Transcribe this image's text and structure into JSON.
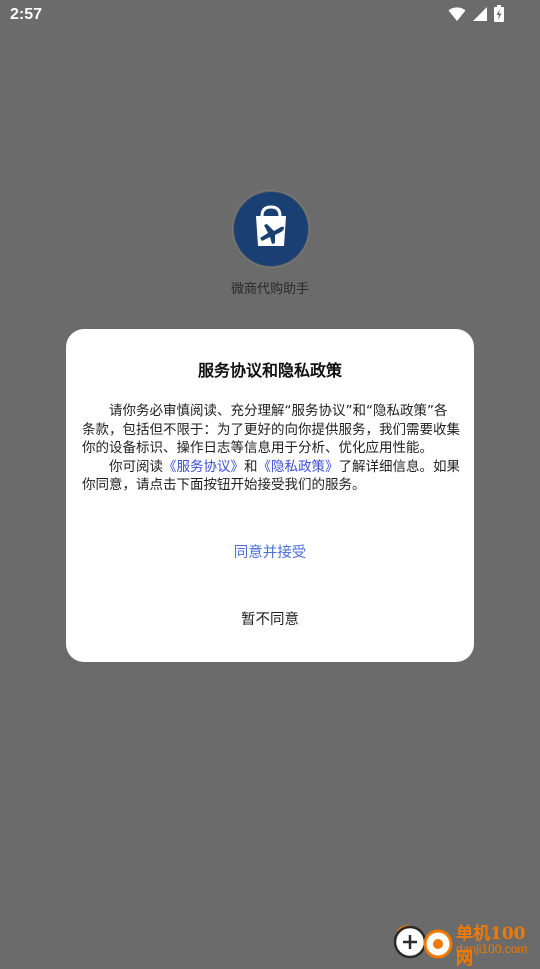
{
  "status_bar": {
    "time": "2:57",
    "icons": [
      "wifi-icon",
      "signal-icon",
      "battery-icon"
    ]
  },
  "app": {
    "name": "微商代购助手",
    "icon": "shopping-bag-airplane-icon"
  },
  "dialog": {
    "title": "服务协议和隐私政策",
    "paragraph1": "请你务必审慎阅读、充分理解“服务协议”和“隐私政策”各条款，包括但不限于：为了更好的向你提供服务，我们需要收集你的设备标识、操作日志等信息用于分析、优化应用性能。",
    "paragraph2_prefix": "你可阅读",
    "link_service": "《服务协议》",
    "paragraph2_and": "和",
    "link_privacy": "《隐私政策》",
    "paragraph2_suffix": "了解详细信息。如果你同意，请点击下面按钮开始接受我们的服务。",
    "agree_label": "同意并接受",
    "disagree_label": "暂不同意"
  },
  "watermark": {
    "title": "单机100网",
    "url": "danji100.com"
  },
  "colors": {
    "overlay": "#6b6b6b",
    "link": "#3a4fd6",
    "agree": "#4a6fd8",
    "icon_bg": "#1a3f73",
    "watermark": "#f07a00"
  }
}
